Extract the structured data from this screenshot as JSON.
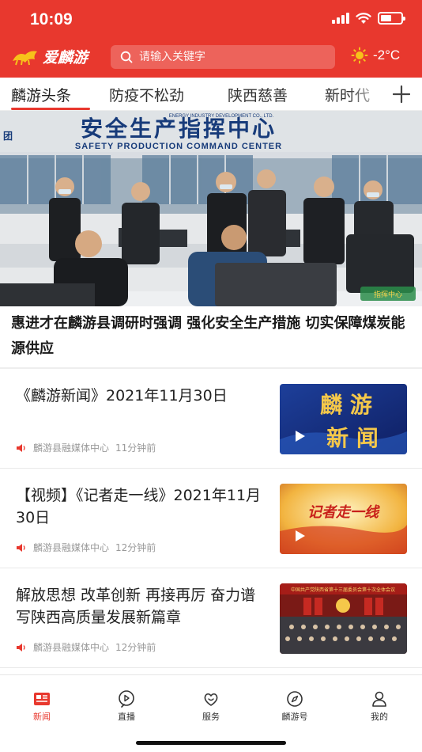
{
  "status_bar": {
    "time": "10:09"
  },
  "header": {
    "logo_text": "爱麟游",
    "search_placeholder": "请输入关键字",
    "temperature": "-2°C",
    "weather_icon": "sun-icon"
  },
  "tabs": [
    {
      "label": "麟游头条",
      "active": true
    },
    {
      "label": "防疫不松劲",
      "active": false
    },
    {
      "label": "陕西慈善",
      "active": false
    },
    {
      "label": "新时代",
      "active": false
    }
  ],
  "tabs_add_icon": "plus-icon",
  "hero": {
    "sign_cn": "安全生产指挥中心",
    "sign_en": "SAFETY PRODUCTION COMMAND CENTER",
    "sign_small": "ENERGY INDUSTRY DEVELOPMENT CO., LTD.",
    "sign_left": "团",
    "watermark": "指挥中心",
    "headline": "惠进才在麟游县调研时强调 强化安全生产措施 切实保障煤炭能源供应"
  },
  "news": [
    {
      "title": "《麟游新闻》2021年11月30日",
      "source": "麟游县融媒体中心",
      "time": "11分钟前",
      "thumb_text_1": "麟 游",
      "thumb_text_2": "新 闻"
    },
    {
      "title": "【视频】《记者走一线》2021年11月30日",
      "source": "麟游县融媒体中心",
      "time": "12分钟前",
      "thumb_text_1": "记者走一线"
    },
    {
      "title": "解放思想 改革创新 再接再厉 奋力谱写陕西高质量发展新篇章",
      "source": "麟游县融媒体中心",
      "time": "12分钟前",
      "thumb_text_1": "中国共产党陕西省第十三届委员会第十次全体会议"
    }
  ],
  "bottom_nav": [
    {
      "label": "新闻",
      "icon": "news-icon",
      "active": true
    },
    {
      "label": "直播",
      "icon": "live-icon",
      "active": false
    },
    {
      "label": "服务",
      "icon": "service-icon",
      "active": false
    },
    {
      "label": "麟游号",
      "icon": "compass-icon",
      "active": false
    },
    {
      "label": "我的",
      "icon": "profile-icon",
      "active": false
    }
  ],
  "colors": {
    "brand_red": "#e8382e",
    "meta_gray": "#999999"
  }
}
